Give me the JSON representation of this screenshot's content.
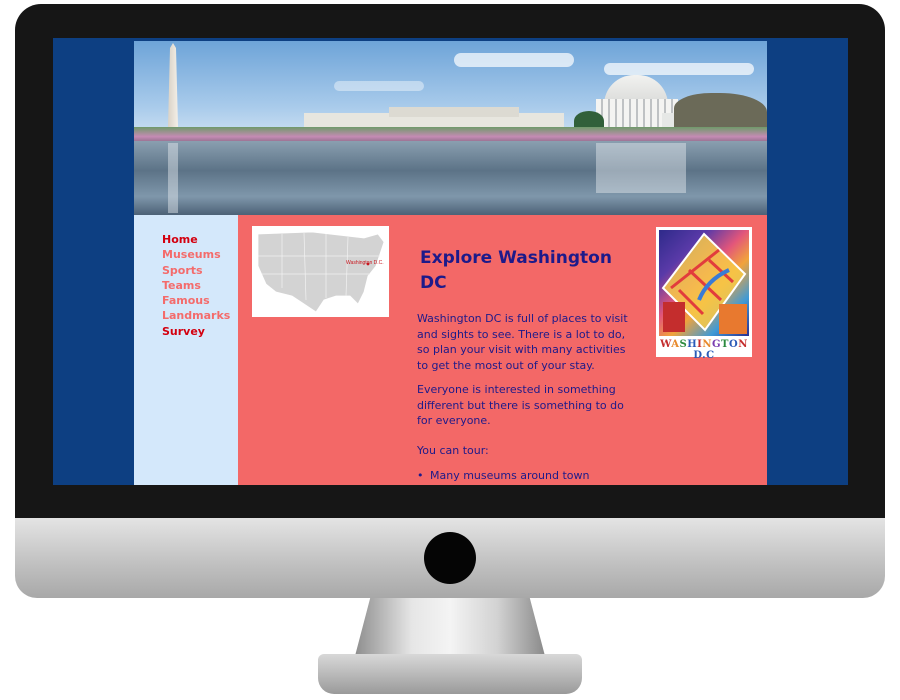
{
  "nav": {
    "items": [
      {
        "label": "Home"
      },
      {
        "label": "Museums"
      },
      {
        "label": "Sports"
      },
      {
        "label": "Teams"
      },
      {
        "label": "Famous"
      },
      {
        "label": "Landmarks"
      },
      {
        "label": "Survey"
      }
    ]
  },
  "map": {
    "label": "Washington D.C."
  },
  "main": {
    "title": "Explore Washington DC",
    "paragraph_1": "Washington DC is full of places to visit and sights to see. There is a lot to do, so plan your visit with many activities to get the most out of your stay.",
    "paragraph_2": "Everyone is interested in something different but there is something to do for everyone.",
    "paragraph_3": "You can tour:",
    "list": [
      "Many museums around town"
    ]
  },
  "poster": {
    "text": "WASHINGTON D.C"
  },
  "colors": {
    "screen_background": "#0d3f82",
    "content_background": "#f36867",
    "sidebar_background": "#d4e8fb",
    "nav_active": "#d3000f",
    "nav_link": "#f46b6b",
    "heading_text": "#1d1a8a"
  },
  "icons": {
    "banner_image": "washington-monument-jefferson-memorial-photo",
    "map_image": "usa-map",
    "poster_image": "washington-dc-map-poster"
  }
}
